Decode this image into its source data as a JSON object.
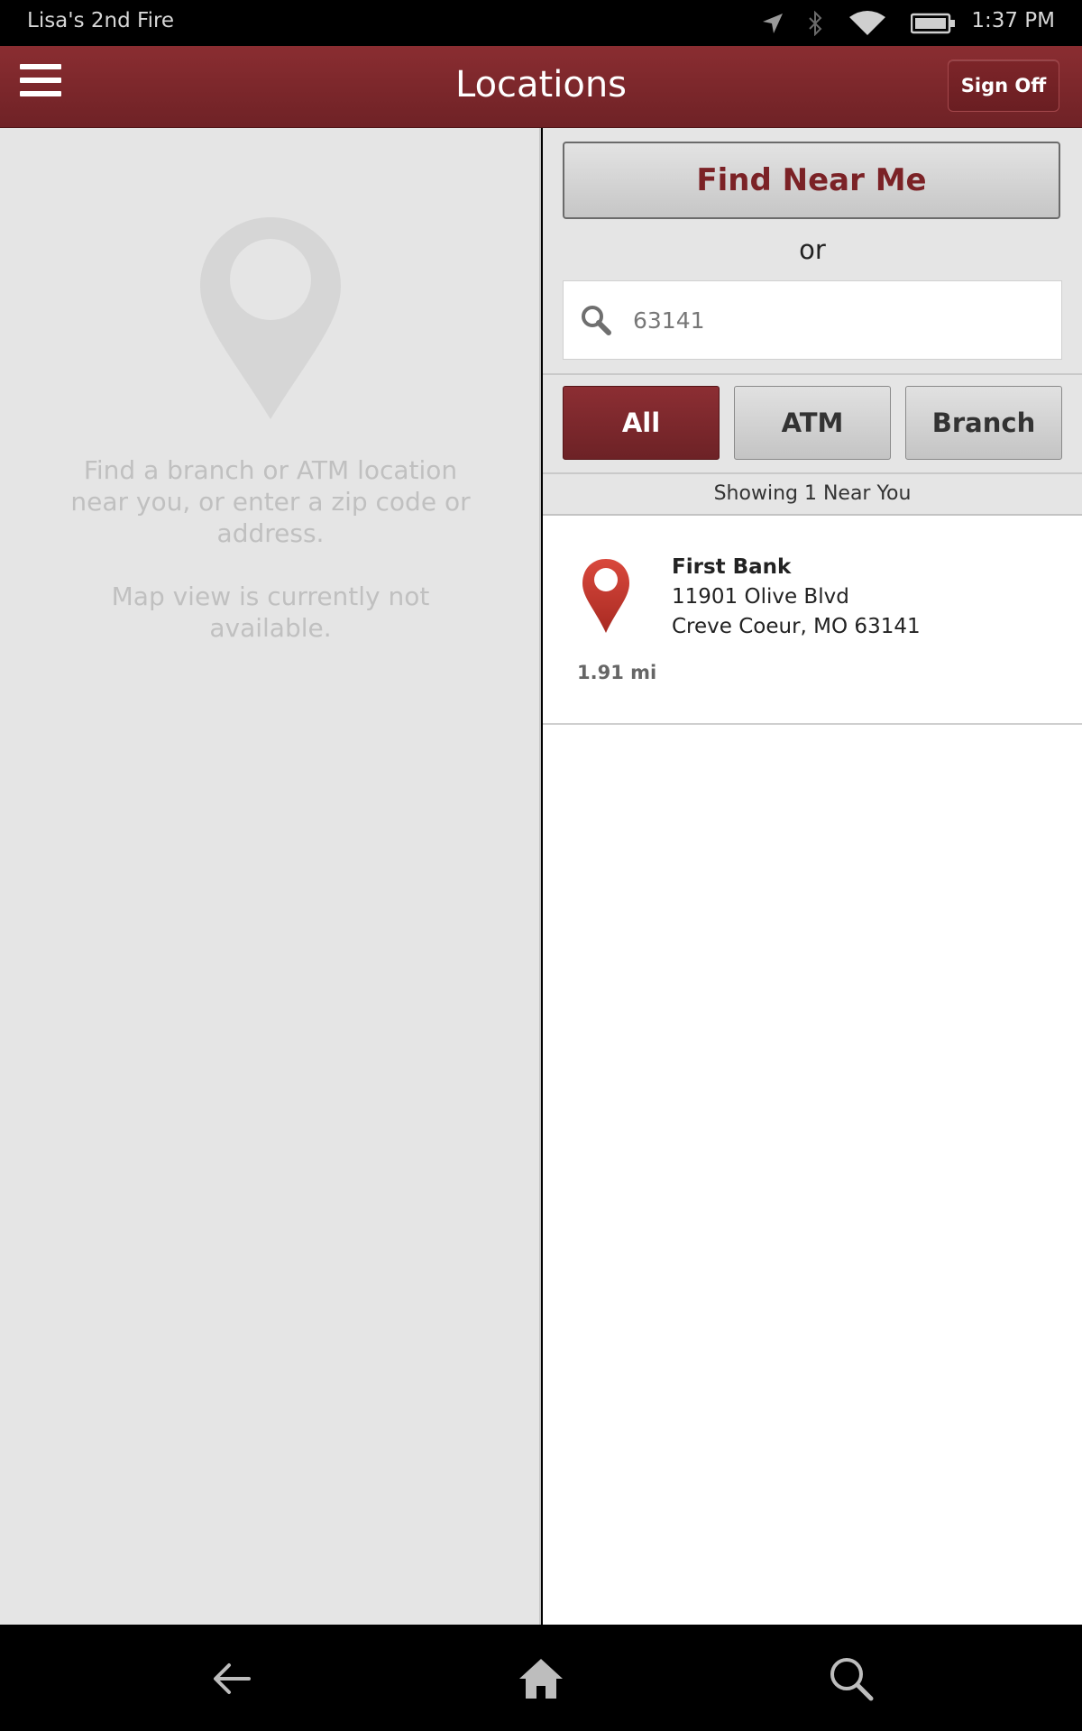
{
  "status_bar": {
    "device_name": "Lisa's 2nd Fire",
    "time": "1:37 PM",
    "icons": [
      "location-arrow-icon",
      "bluetooth-icon",
      "wifi-icon",
      "battery-icon"
    ]
  },
  "header": {
    "title": "Locations",
    "sign_off_label": "Sign Off",
    "menu_icon": "hamburger-menu-icon"
  },
  "map": {
    "message_line": "Find a branch or ATM location near you, or enter a zip code or address.",
    "unavailable_line": "Map view is currently not available."
  },
  "search": {
    "find_near_me_label": "Find Near Me",
    "or_text": "or",
    "query_value": "63141"
  },
  "filters": {
    "items": [
      {
        "label": "All",
        "active": true
      },
      {
        "label": "ATM",
        "active": false
      },
      {
        "label": "Branch",
        "active": false
      }
    ]
  },
  "results": {
    "summary": "Showing 1 Near You",
    "items": [
      {
        "name": "First Bank",
        "address_line1": "11901 Olive Blvd",
        "address_line2": "Creve Coeur, MO 63141",
        "distance": "1.91 mi"
      }
    ]
  },
  "nav": {
    "icons": [
      "back-arrow-icon",
      "home-icon",
      "search-icon"
    ]
  },
  "colors": {
    "brand_red": "#7b2226",
    "pin_red": "#c0392b",
    "panel_gray": "#e5e5e5"
  }
}
